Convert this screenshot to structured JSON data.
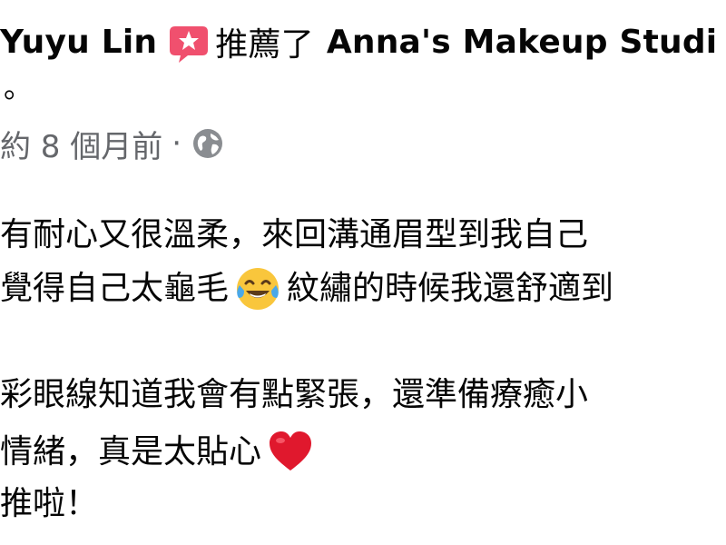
{
  "post": {
    "author": "Yuyu Lin",
    "recommend_icon": "recommend-badge-icon",
    "recommend_text": "推薦了",
    "page_name": "Anna's Makeup Studi",
    "period": "。",
    "meta": {
      "time": "約 8 個月前",
      "separator": "·",
      "audience_icon": "globe-icon"
    },
    "body_lines": [
      {
        "text": "有耐心又很溫柔，來回溝通眉型到我自己"
      },
      {
        "before": "覺得自己太龜毛",
        "emoji": "tears-of-joy-emoji",
        "after": "紋繡的時候我還舒適到"
      },
      {
        "text": "彩眼線知道我會有點緊張，還準備療癒小"
      },
      {
        "before": "情緒，真是太貼心",
        "emoji": "red-heart-emoji",
        "after": ""
      },
      {
        "text": "推啦！"
      }
    ]
  },
  "colors": {
    "text": "#050505",
    "meta_text": "#65676b",
    "recommend_badge": "#f0506e",
    "heart": "#e0182d",
    "emoji_face": "#f9c63c"
  }
}
